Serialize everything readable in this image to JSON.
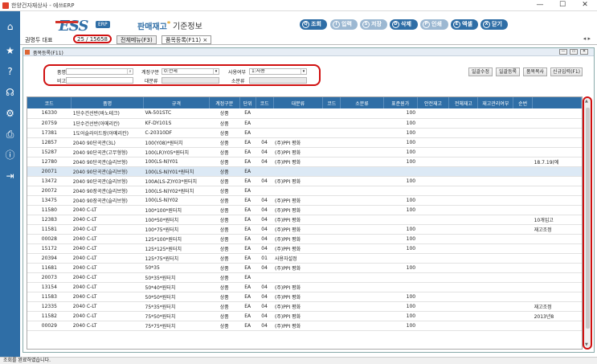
{
  "app": {
    "title": "한양건자재상사 - 에쓰ERP"
  },
  "window_controls": {
    "minimize": "—",
    "maximize": "☐",
    "close": "✕"
  },
  "header": {
    "logo": "ESS",
    "erp_badge": "ERP",
    "menu_title": "판매재고",
    "menu_title_mark": "*",
    "menu_sub": "기준정보"
  },
  "toolbar": [
    {
      "label": "조회",
      "icon": "Q",
      "enabled": true
    },
    {
      "label": "입력",
      "icon": "I",
      "enabled": false
    },
    {
      "label": "저장",
      "icon": "S",
      "enabled": false
    },
    {
      "label": "삭제",
      "icon": "D",
      "enabled": true
    },
    {
      "label": "인쇄",
      "icon": "P",
      "enabled": false
    },
    {
      "label": "엑셀",
      "icon": "E",
      "enabled": true
    },
    {
      "label": "닫기",
      "icon": "X",
      "enabled": true
    }
  ],
  "tabs": {
    "user": "권명두 대표",
    "counter": "25 / 15658",
    "items": [
      "전체메뉴(F3)",
      "품목등록(F11) ×"
    ],
    "nav": "◂ ▸"
  },
  "form_window": {
    "title": "품목등록(F11)",
    "buttons": [
      "—",
      "▭",
      "✕"
    ]
  },
  "filter": {
    "item_name_label": "품명",
    "item_name_value": "",
    "account_label": "계정구분",
    "account_value": "0:전체",
    "use_label": "사용여부",
    "use_value": "1:사용",
    "note_label": "비고",
    "note_value": "",
    "major_label": "대분류",
    "major_value": "",
    "minor_label": "소분류",
    "minor_value": ""
  },
  "right_buttons": [
    "일괄수정",
    "일괄등록",
    "품목복사",
    "신규입력(F1)"
  ],
  "table": {
    "columns": [
      "코드",
      "품명",
      "규격",
      "계정구분",
      "단위",
      "코드",
      "대분류",
      "코드",
      "소분류",
      "표준원가",
      "안전재고",
      "전체재고",
      "재고관리여부",
      "순번",
      ""
    ],
    "rows": [
      [
        "16330",
        "1단수건선반(바노테크)",
        "VA-501STC",
        "상품",
        "EA",
        "",
        "",
        "",
        "",
        "100",
        "",
        "",
        "",
        "",
        ""
      ],
      [
        "20759",
        "1단수건선반(아메리칸)",
        "KF-DY101S",
        "상품",
        "EA",
        "",
        "",
        "",
        "",
        "100",
        "",
        "",
        "",
        "",
        ""
      ],
      [
        "17381",
        "1도어슬라이드장(아메리칸)",
        "C-20310DF",
        "상품",
        "EA",
        "",
        "",
        "",
        "",
        "100",
        "",
        "",
        "",
        "",
        ""
      ],
      [
        "12857",
        "2040 90단곡관(3L)",
        "100(Y08)*원터치",
        "상품",
        "EA",
        "04",
        "(주)PPI 평화",
        "",
        "",
        "100",
        "",
        "",
        "",
        "",
        ""
      ],
      [
        "15287",
        "2040 90단곡관(고무형형)",
        "100(LR)Y05*원터치",
        "상품",
        "EA",
        "04",
        "(주)PPI 평화",
        "",
        "",
        "100",
        "",
        "",
        "",
        "",
        ""
      ],
      [
        "12780",
        "2040 90단곡관(슬리브형)",
        "100(LS-N)Y01",
        "상품",
        "EA",
        "04",
        "(주)PPI 평화",
        "",
        "",
        "100",
        "",
        "",
        "",
        "",
        "18.7.19(에"
      ],
      [
        "20071",
        "2040 90단곡관(슬리브형)",
        "100(LS-N)Y01*원터치",
        "상품",
        "EA",
        "",
        "",
        "",
        "",
        "",
        "",
        "",
        "",
        "",
        ""
      ],
      [
        "13472",
        "2040 90단곡관(슬리브형)",
        "100A(LS-Z)Y03*원터치",
        "상품",
        "EA",
        "04",
        "(주)PPI 평화",
        "",
        "",
        "100",
        "",
        "",
        "",
        "",
        ""
      ],
      [
        "20072",
        "2040 90장곡관(슬리브형)",
        "100(LS-N)Y02*원터치",
        "상품",
        "EA",
        "",
        "",
        "",
        "",
        "",
        "",
        "",
        "",
        "",
        ""
      ],
      [
        "13475",
        "2040 90장곡관(슬리브형)",
        "100(LS-N)Y02",
        "상품",
        "EA",
        "04",
        "(주)PPI 평화",
        "",
        "",
        "100",
        "",
        "",
        "",
        "",
        ""
      ],
      [
        "11580",
        "2040 C-LT",
        "100*100*원터치",
        "상품",
        "EA",
        "04",
        "(주)PPI 평화",
        "",
        "",
        "100",
        "",
        "",
        "",
        "",
        ""
      ],
      [
        "12383",
        "2040 C-LT",
        "100*50*원터치",
        "상품",
        "EA",
        "04",
        "(주)PPI 평화",
        "",
        "",
        "",
        "",
        "",
        "",
        "",
        "10개입고"
      ],
      [
        "11581",
        "2040 C-LT",
        "100*75*원터치",
        "상품",
        "EA",
        "04",
        "(주)PPI 평화",
        "",
        "",
        "100",
        "",
        "",
        "",
        "",
        "재고조정"
      ],
      [
        "00028",
        "2040 C-LT",
        "125*100*원터치",
        "상품",
        "EA",
        "04",
        "(주)PPI 평화",
        "",
        "",
        "100",
        "",
        "",
        "",
        "",
        ""
      ],
      [
        "15172",
        "2040 C-LT",
        "125*125*원터치",
        "상품",
        "EA",
        "04",
        "(주)PPI 평화",
        "",
        "",
        "100",
        "",
        "",
        "",
        "",
        ""
      ],
      [
        "20394",
        "2040 C-LT",
        "125*75*원터치",
        "상품",
        "EA",
        "01",
        "사용자설정",
        "",
        "",
        "",
        "",
        "",
        "",
        "",
        ""
      ],
      [
        "11681",
        "2040 C-LT",
        "50*35",
        "상품",
        "EA",
        "04",
        "(주)PPI 평화",
        "",
        "",
        "100",
        "",
        "",
        "",
        "",
        ""
      ],
      [
        "20073",
        "2040 C-LT",
        "50*35*원터치",
        "상품",
        "EA",
        "",
        "",
        "",
        "",
        "",
        "",
        "",
        "",
        "",
        ""
      ],
      [
        "13154",
        "2040 C-LT",
        "50*40*원터치",
        "상품",
        "EA",
        "04",
        "(주)PPI 평화",
        "",
        "",
        "",
        "",
        "",
        "",
        "",
        ""
      ],
      [
        "11583",
        "2040 C-LT",
        "50*50*원터치",
        "상품",
        "EA",
        "04",
        "(주)PPI 평화",
        "",
        "",
        "100",
        "",
        "",
        "",
        "",
        ""
      ],
      [
        "12335",
        "2040 C-LT",
        "75*35*원터치",
        "상품",
        "EA",
        "04",
        "(주)PPI 평화",
        "",
        "",
        "100",
        "",
        "",
        "",
        "",
        "재고조정"
      ],
      [
        "11582",
        "2040 C-LT",
        "75*50*원터치",
        "상품",
        "EA",
        "04",
        "(주)PPI 평화",
        "",
        "",
        "100",
        "",
        "",
        "",
        "",
        "2013년8"
      ],
      [
        "00029",
        "2040 C-LT",
        "75*75*원터치",
        "상품",
        "EA",
        "04",
        "(주)PPI 평화",
        "",
        "",
        "100",
        "",
        "",
        "",
        "",
        ""
      ]
    ]
  },
  "status": {
    "text": "조회를 완료하였습니다."
  },
  "colors": {
    "accent": "#2f6ea6",
    "highlight": "#d01010",
    "selected_row": "#dce9f5"
  }
}
